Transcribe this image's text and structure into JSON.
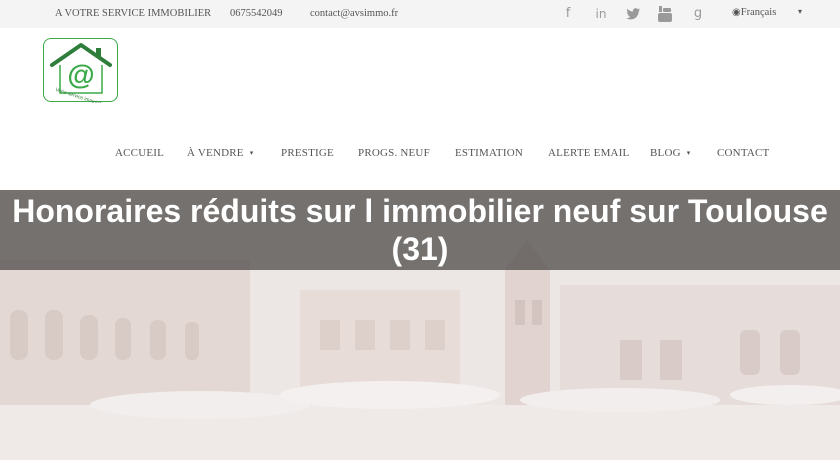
{
  "topbar": {
    "company": "A VOTRE SERVICE IMMOBILIER",
    "phone": "0675542049",
    "email": "contact@avsimmo.fr",
    "social_icons": [
      "facebook-icon",
      "linkedin-icon",
      "twitter-icon",
      "youtube-icon",
      "google-plus-icon"
    ],
    "social_glyphs": {
      "facebook": "f",
      "linkedin": "in",
      "twitter": "🐦",
      "youtube": "▶",
      "google": "g"
    },
    "language": "Français",
    "language_caret": "▾",
    "globe": "🌐"
  },
  "logo": {
    "text": "Votre service immobilier",
    "symbol": "@",
    "color": "#3aaa48"
  },
  "nav": {
    "items": [
      {
        "label": "ACCUEIL",
        "dropdown": false
      },
      {
        "label": "À VENDRE",
        "dropdown": true
      },
      {
        "label": "PRESTIGE",
        "dropdown": false
      },
      {
        "label": "PROGS. NEUF",
        "dropdown": false
      },
      {
        "label": "ESTIMATION",
        "dropdown": false
      },
      {
        "label": "ALERTE EMAIL",
        "dropdown": false
      },
      {
        "label": "BLOG",
        "dropdown": true
      },
      {
        "label": "CONTACT",
        "dropdown": false
      }
    ],
    "caret": "▾"
  },
  "hero": {
    "title": "Honoraires réduits sur l immobilier neuf sur Toulouse (31)",
    "band_color": "#5f5c5a"
  }
}
